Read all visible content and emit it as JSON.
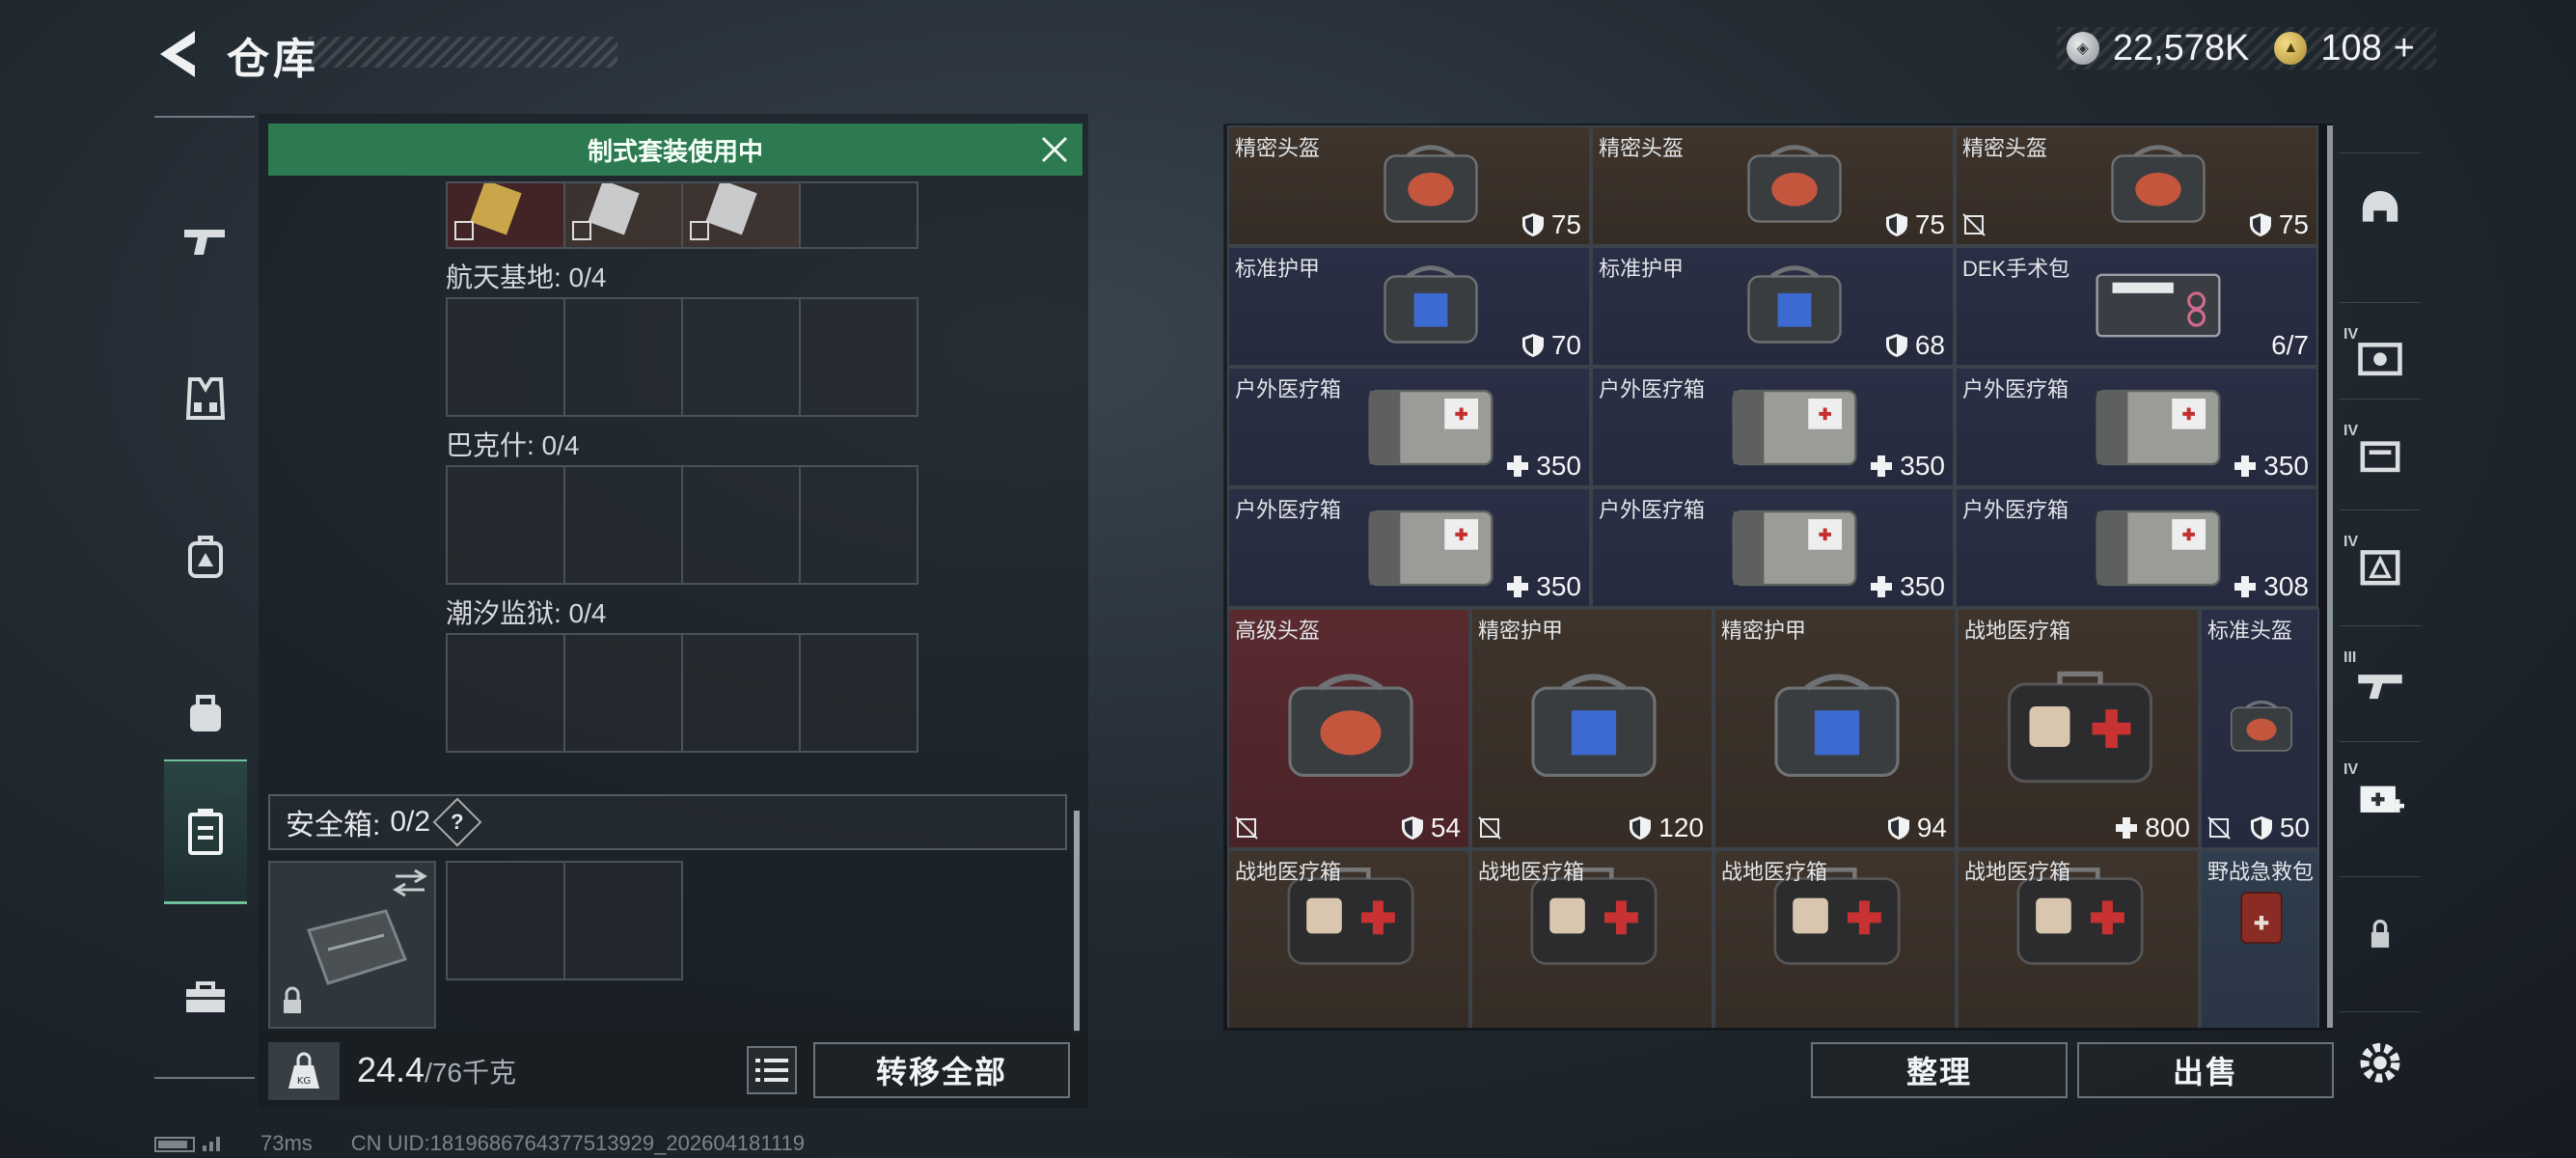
{
  "header": {
    "title": "仓库",
    "currency": [
      {
        "icon": "silver-coin-icon",
        "value": "22,578K"
      },
      {
        "icon": "gold-coin-icon",
        "value": "108",
        "add": "+"
      }
    ]
  },
  "loadout": {
    "banner": "制式套装使用中",
    "zones": [
      {
        "label": "航天基地: 0/4"
      },
      {
        "label": "巴克什: 0/4"
      },
      {
        "label": "潮汐监狱: 0/4"
      }
    ],
    "safe_box": {
      "label": "安全箱:",
      "count": "0/2",
      "help": "?"
    },
    "weight": {
      "current": "24.4",
      "max": "/76千克"
    },
    "transfer_all": "转移全部"
  },
  "inventory": {
    "items": [
      {
        "name": "精密头盔",
        "value": "75",
        "stat": "armor",
        "color": "brown"
      },
      {
        "name": "精密头盔",
        "value": "75",
        "stat": "armor",
        "color": "brown"
      },
      {
        "name": "精密头盔",
        "value": "75",
        "stat": "armor",
        "color": "brown",
        "no_insure": true
      },
      {
        "name": "标准护甲",
        "value": "70",
        "stat": "armor",
        "color": "navy"
      },
      {
        "name": "标准护甲",
        "value": "68",
        "stat": "armor",
        "color": "navy"
      },
      {
        "name": "DEK手术包",
        "value": "6/7",
        "stat": "count",
        "color": "navy"
      },
      {
        "name": "户外医疗箱",
        "value": "350",
        "stat": "heal",
        "color": "navy"
      },
      {
        "name": "户外医疗箱",
        "value": "350",
        "stat": "heal",
        "color": "navy"
      },
      {
        "name": "户外医疗箱",
        "value": "350",
        "stat": "heal",
        "color": "navy"
      },
      {
        "name": "户外医疗箱",
        "value": "350",
        "stat": "heal",
        "color": "navy"
      },
      {
        "name": "户外医疗箱",
        "value": "350",
        "stat": "heal",
        "color": "navy"
      },
      {
        "name": "户外医疗箱",
        "value": "308",
        "stat": "heal",
        "color": "navy"
      },
      {
        "name": "高级头盔",
        "value": "54",
        "stat": "armor",
        "color": "red",
        "no_insure": true
      },
      {
        "name": "精密护甲",
        "value": "120",
        "stat": "armor",
        "color": "brown",
        "no_insure": true
      },
      {
        "name": "精密护甲",
        "value": "94",
        "stat": "armor",
        "color": "brown"
      },
      {
        "name": "战地医疗箱",
        "value": "800",
        "stat": "heal",
        "color": "brown"
      },
      {
        "name": "标准头盔",
        "value": "50",
        "stat": "armor",
        "color": "navy",
        "no_insure": true
      },
      {
        "name": "战地医疗箱",
        "value": "",
        "stat": "none",
        "color": "brown"
      },
      {
        "name": "战地医疗箱",
        "value": "",
        "stat": "none",
        "color": "brown"
      },
      {
        "name": "战地医疗箱",
        "value": "",
        "stat": "none",
        "color": "brown"
      },
      {
        "name": "战地医疗箱",
        "value": "",
        "stat": "none",
        "color": "brown"
      },
      {
        "name": "野战急救包",
        "value": "",
        "stat": "none",
        "color": "teal"
      }
    ],
    "organize": "整理",
    "sell": "出售"
  },
  "left_nav": [
    "gun-icon",
    "vest-icon",
    "backpack-icon",
    "pouch-icon",
    "safe-box-icon",
    "toolbox-icon"
  ],
  "right_nav": [
    "helmet-filter-icon",
    "armor-filter-icon",
    "bag-filter-icon",
    "rig-filter-icon",
    "gun-filter-icon",
    "medkit-filter-icon",
    "lock-icon",
    "settings-icon"
  ],
  "right_nav_tiers": [
    "",
    "IV",
    "IV",
    "IV",
    "III",
    "IV",
    "",
    ""
  ],
  "status": {
    "ping": "73ms",
    "uid": "CN UID:1819686764377513929_202604181119"
  }
}
